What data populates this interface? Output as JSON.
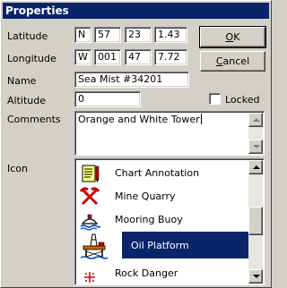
{
  "window": {
    "title": "Properties"
  },
  "latitude": {
    "label": "Latitude",
    "hemisphere": "N",
    "degrees": "57",
    "minutes": "23",
    "seconds": "1.43"
  },
  "longitude": {
    "label": "Longitude",
    "hemisphere": "W",
    "degrees": "001",
    "minutes": "47",
    "seconds": "7.72"
  },
  "name": {
    "label": "Name",
    "value": "Sea Mist #34201"
  },
  "altitude": {
    "label": "Altitude",
    "value": "0"
  },
  "locked": {
    "label": "Locked",
    "checked": false
  },
  "comments": {
    "label": "Comments",
    "value": "Orange and White Tower"
  },
  "buttons": {
    "ok_label": "OK",
    "ok_accel": "O",
    "ok_rest": "K",
    "cancel_label": "Cancel",
    "cancel_accel": "C",
    "cancel_rest": "ancel"
  },
  "icon": {
    "label": "Icon",
    "items": [
      {
        "label": "Chart Annotation",
        "icon": "chart-annotation-icon"
      },
      {
        "label": "Mine Quarry",
        "icon": "mine-quarry-icon"
      },
      {
        "label": "Mooring Buoy",
        "icon": "mooring-buoy-icon"
      },
      {
        "label": "Oil Platform",
        "icon": "oil-platform-icon",
        "selected": true
      },
      {
        "label": "Rock Danger",
        "icon": "rock-danger-icon"
      }
    ]
  },
  "colors": {
    "title_bar": "#0a246a",
    "selection": "#0a246a",
    "face": "#d4d0c8"
  }
}
